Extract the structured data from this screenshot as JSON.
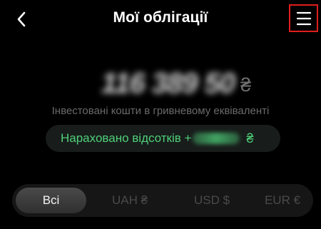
{
  "header": {
    "title": "Мої облігації",
    "back_icon": "chevron-left-icon",
    "menu_icon": "hamburger-menu-icon"
  },
  "summary": {
    "amount_masked": "116 389 50",
    "amount_currency": "₴",
    "subtitle": "Інвестовані кошти в гривневому еквіваленті"
  },
  "interest": {
    "label": "Нараховано відсотків +",
    "currency": "₴",
    "color": "#4fd07a"
  },
  "currency_tabs": [
    {
      "label": "Всі",
      "active": true
    },
    {
      "label": "UAH ₴",
      "active": false
    },
    {
      "label": "USD $",
      "active": false
    },
    {
      "label": "EUR €",
      "active": false
    }
  ],
  "colors": {
    "background": "#000000",
    "highlight_border": "#e01e1e",
    "accent_green": "#4fd07a"
  }
}
